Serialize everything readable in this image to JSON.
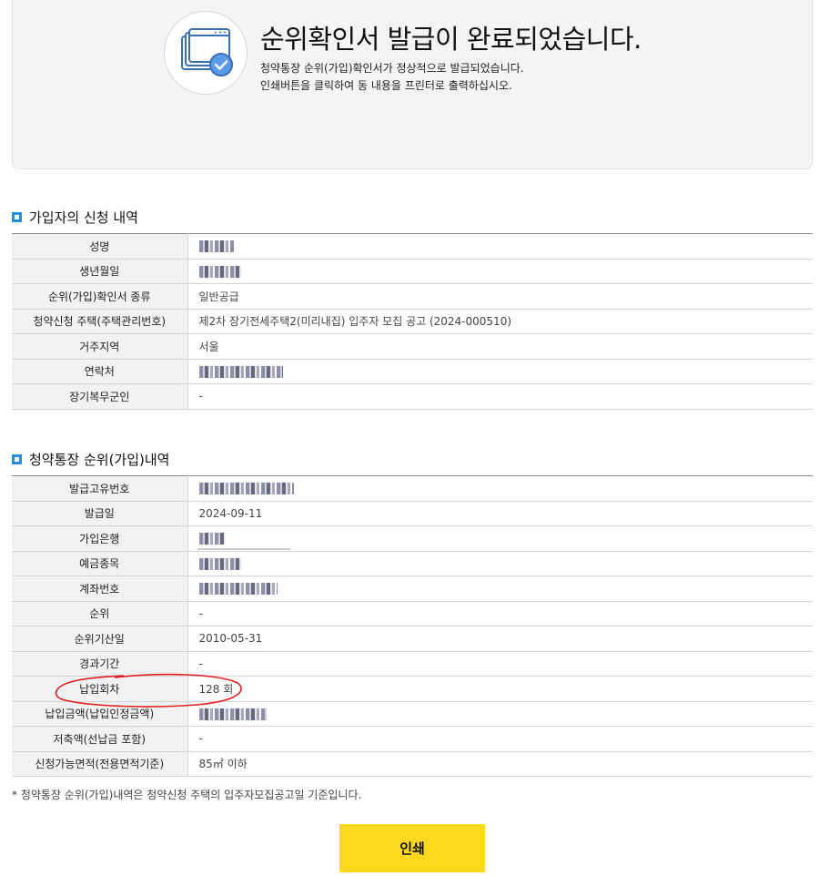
{
  "banner": {
    "title": "순위확인서 발급이 완료되었습니다.",
    "line1": "청약통장 순위(가입)확인서가 정상적으로 발급되었습니다.",
    "line2": "인쇄버튼을 클릭하여 동 내용을 프린터로 출력하십시오.",
    "icon": "certificate-check-icon"
  },
  "applicant": {
    "title": "가입자의 신청 내역",
    "rows": [
      {
        "label": "성명",
        "value": "",
        "masked": true,
        "mask_width": 38
      },
      {
        "label": "생년월일",
        "value": "",
        "masked": true,
        "mask_width": 46
      },
      {
        "label": "순위(가입)확인서 종류",
        "value": "일반공급",
        "masked": false
      },
      {
        "label": "청약신청 주택(주택관리번호)",
        "value": "제2차 장기전세주택2(미리내집) 입주자 모집 공고 (2024-000510)",
        "masked": false
      },
      {
        "label": "거주지역",
        "value": "서울",
        "masked": false
      },
      {
        "label": "연락처",
        "value": "",
        "masked": true,
        "mask_width": 92
      },
      {
        "label": "장기복무군인",
        "value": "-",
        "masked": false
      }
    ]
  },
  "account": {
    "title": "청약통장 순위(가입)내역",
    "rows": [
      {
        "label": "발급고유번호",
        "value": "",
        "masked": true,
        "mask_width": 104
      },
      {
        "label": "발급일",
        "value": "2024-09-11",
        "masked": false
      },
      {
        "label": "가입은행",
        "value": "",
        "masked": true,
        "mask_width": 28
      },
      {
        "label": "예금종목",
        "value": "",
        "masked": true,
        "mask_width": 46
      },
      {
        "label": "계좌번호",
        "value": "",
        "masked": true,
        "mask_width": 86
      },
      {
        "label": "순위",
        "value": "-",
        "masked": false
      },
      {
        "label": "순위기산일",
        "value": "2010-05-31",
        "masked": false
      },
      {
        "label": "경과기간",
        "value": "-",
        "masked": false
      },
      {
        "label": "납입회차",
        "value": "128 회",
        "masked": false
      },
      {
        "label": "납입금액(납입인정금액)",
        "value": "",
        "masked": true,
        "mask_width": 74
      },
      {
        "label": "저축액(선납금 포함)",
        "value": "-",
        "masked": false
      },
      {
        "label": "신청가능면적(전용면적기준)",
        "value": "85㎡ 이하",
        "masked": false
      }
    ]
  },
  "note": "* 청약통장 순위(가입)내역은 청약신청 주택의 입주자모집공고일 기준입니다.",
  "print_label": "인쇄",
  "colors": {
    "accent": "#1d8ee0",
    "button": "#fcd920",
    "annotation": "#e02020"
  }
}
